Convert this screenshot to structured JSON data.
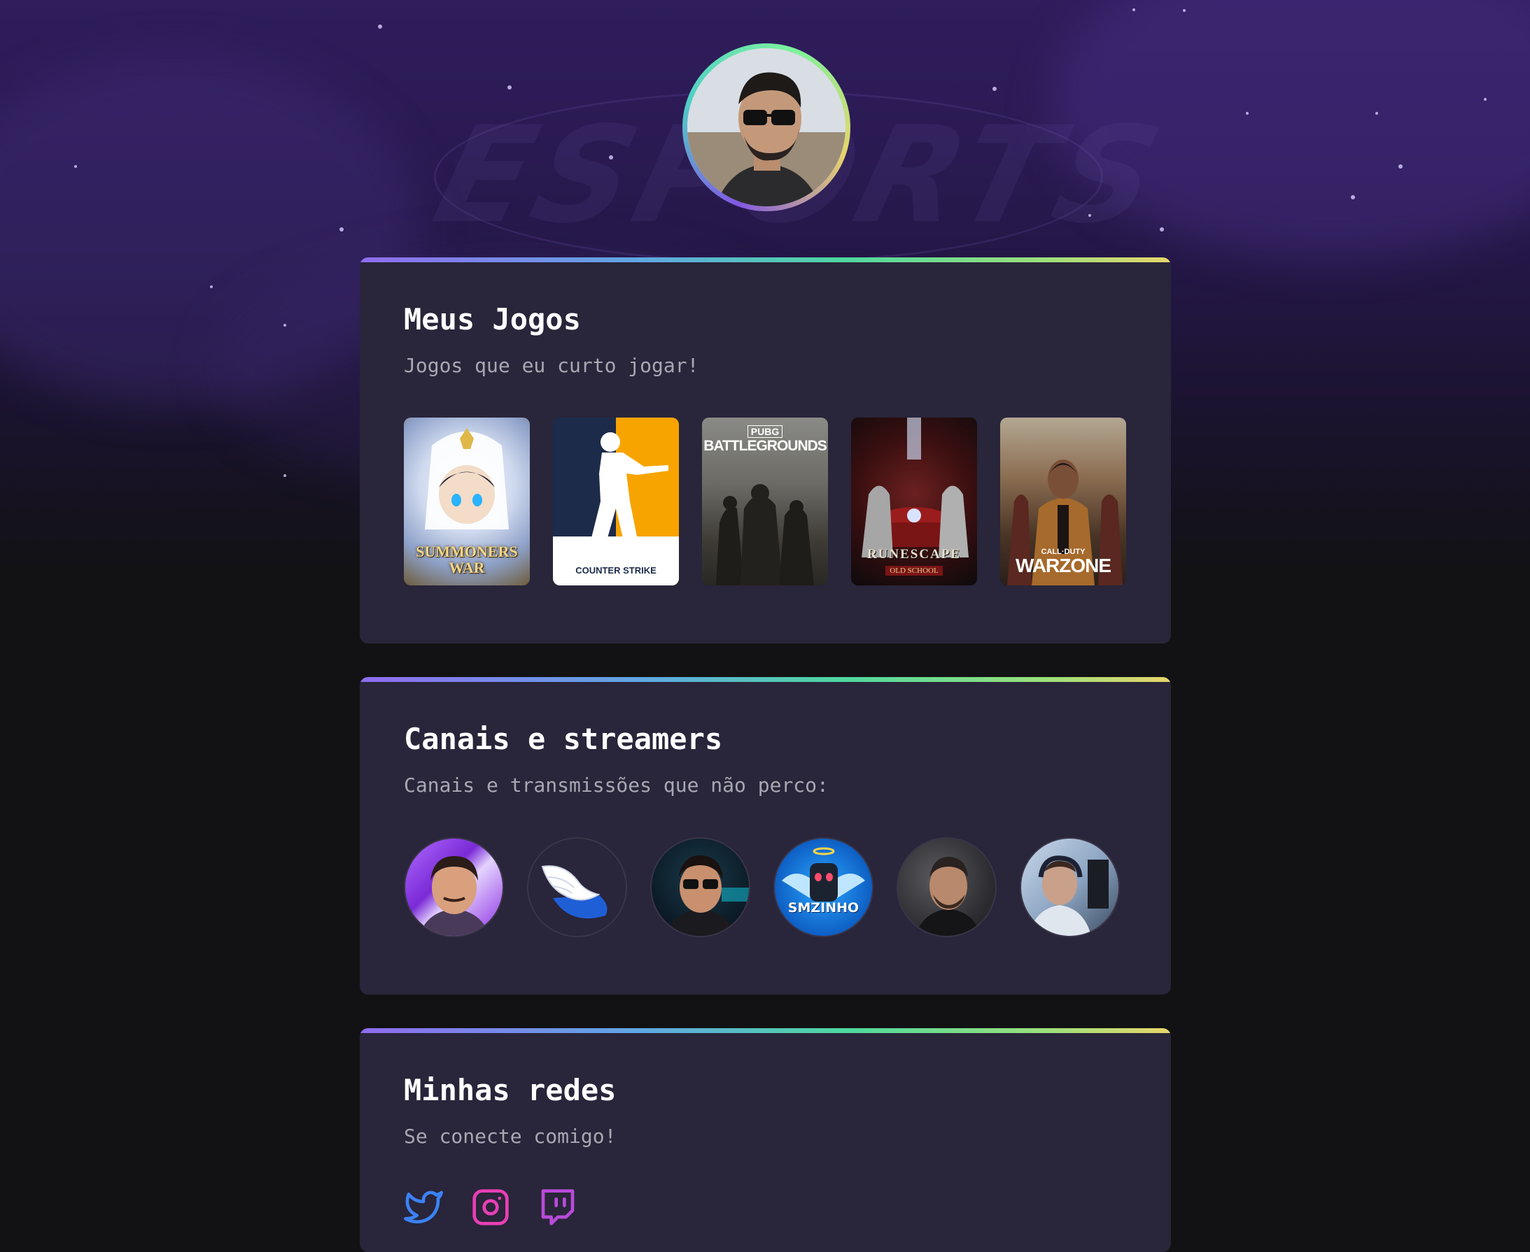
{
  "profile": {
    "avatar_icon": "profile-photo"
  },
  "background": {
    "watermark_text": "ESPORTS"
  },
  "games_section": {
    "title": "Meus Jogos",
    "subtitle": "Jogos que eu curto jogar!",
    "games": [
      {
        "name": "Summoners War",
        "label": "SUMMONERS WAR"
      },
      {
        "name": "Counter Strike",
        "label": "COUNTER STRIKE"
      },
      {
        "name": "PUBG Battlegrounds",
        "label_top": "PUBG",
        "label": "BATTLEGROUNDS"
      },
      {
        "name": "RuneScape Old School",
        "label": "RUNESCAPE",
        "label_sub": "OLD SCHOOL"
      },
      {
        "name": "Call of Duty Warzone",
        "label_top": "CALL·DUTY",
        "label": "WARZONE"
      }
    ]
  },
  "streamers_section": {
    "title": "Canais e streamers",
    "subtitle": "Canais e transmissões que não perco:",
    "streamers": [
      {
        "avatar": "streamer-1"
      },
      {
        "avatar": "streamer-2-wing-logo"
      },
      {
        "avatar": "streamer-3"
      },
      {
        "avatar": "streamer-4",
        "label": "SMZINHO"
      },
      {
        "avatar": "streamer-5"
      },
      {
        "avatar": "streamer-6"
      }
    ]
  },
  "social_section": {
    "title": "Minhas redes",
    "subtitle": "Se conecte comigo!",
    "links": [
      {
        "icon": "twitter-icon",
        "color": "#3b82f6"
      },
      {
        "icon": "instagram-icon",
        "color": "#e83fb5"
      },
      {
        "icon": "twitch-icon",
        "color": "#b84bd9"
      }
    ]
  },
  "colors": {
    "background": "#121214",
    "card": "#29253a",
    "accent_gradient": [
      "#8f6cf0",
      "#4fd89f",
      "#e8d56b"
    ],
    "title": "#ffffff",
    "subtitle": "#a8a8b3"
  }
}
